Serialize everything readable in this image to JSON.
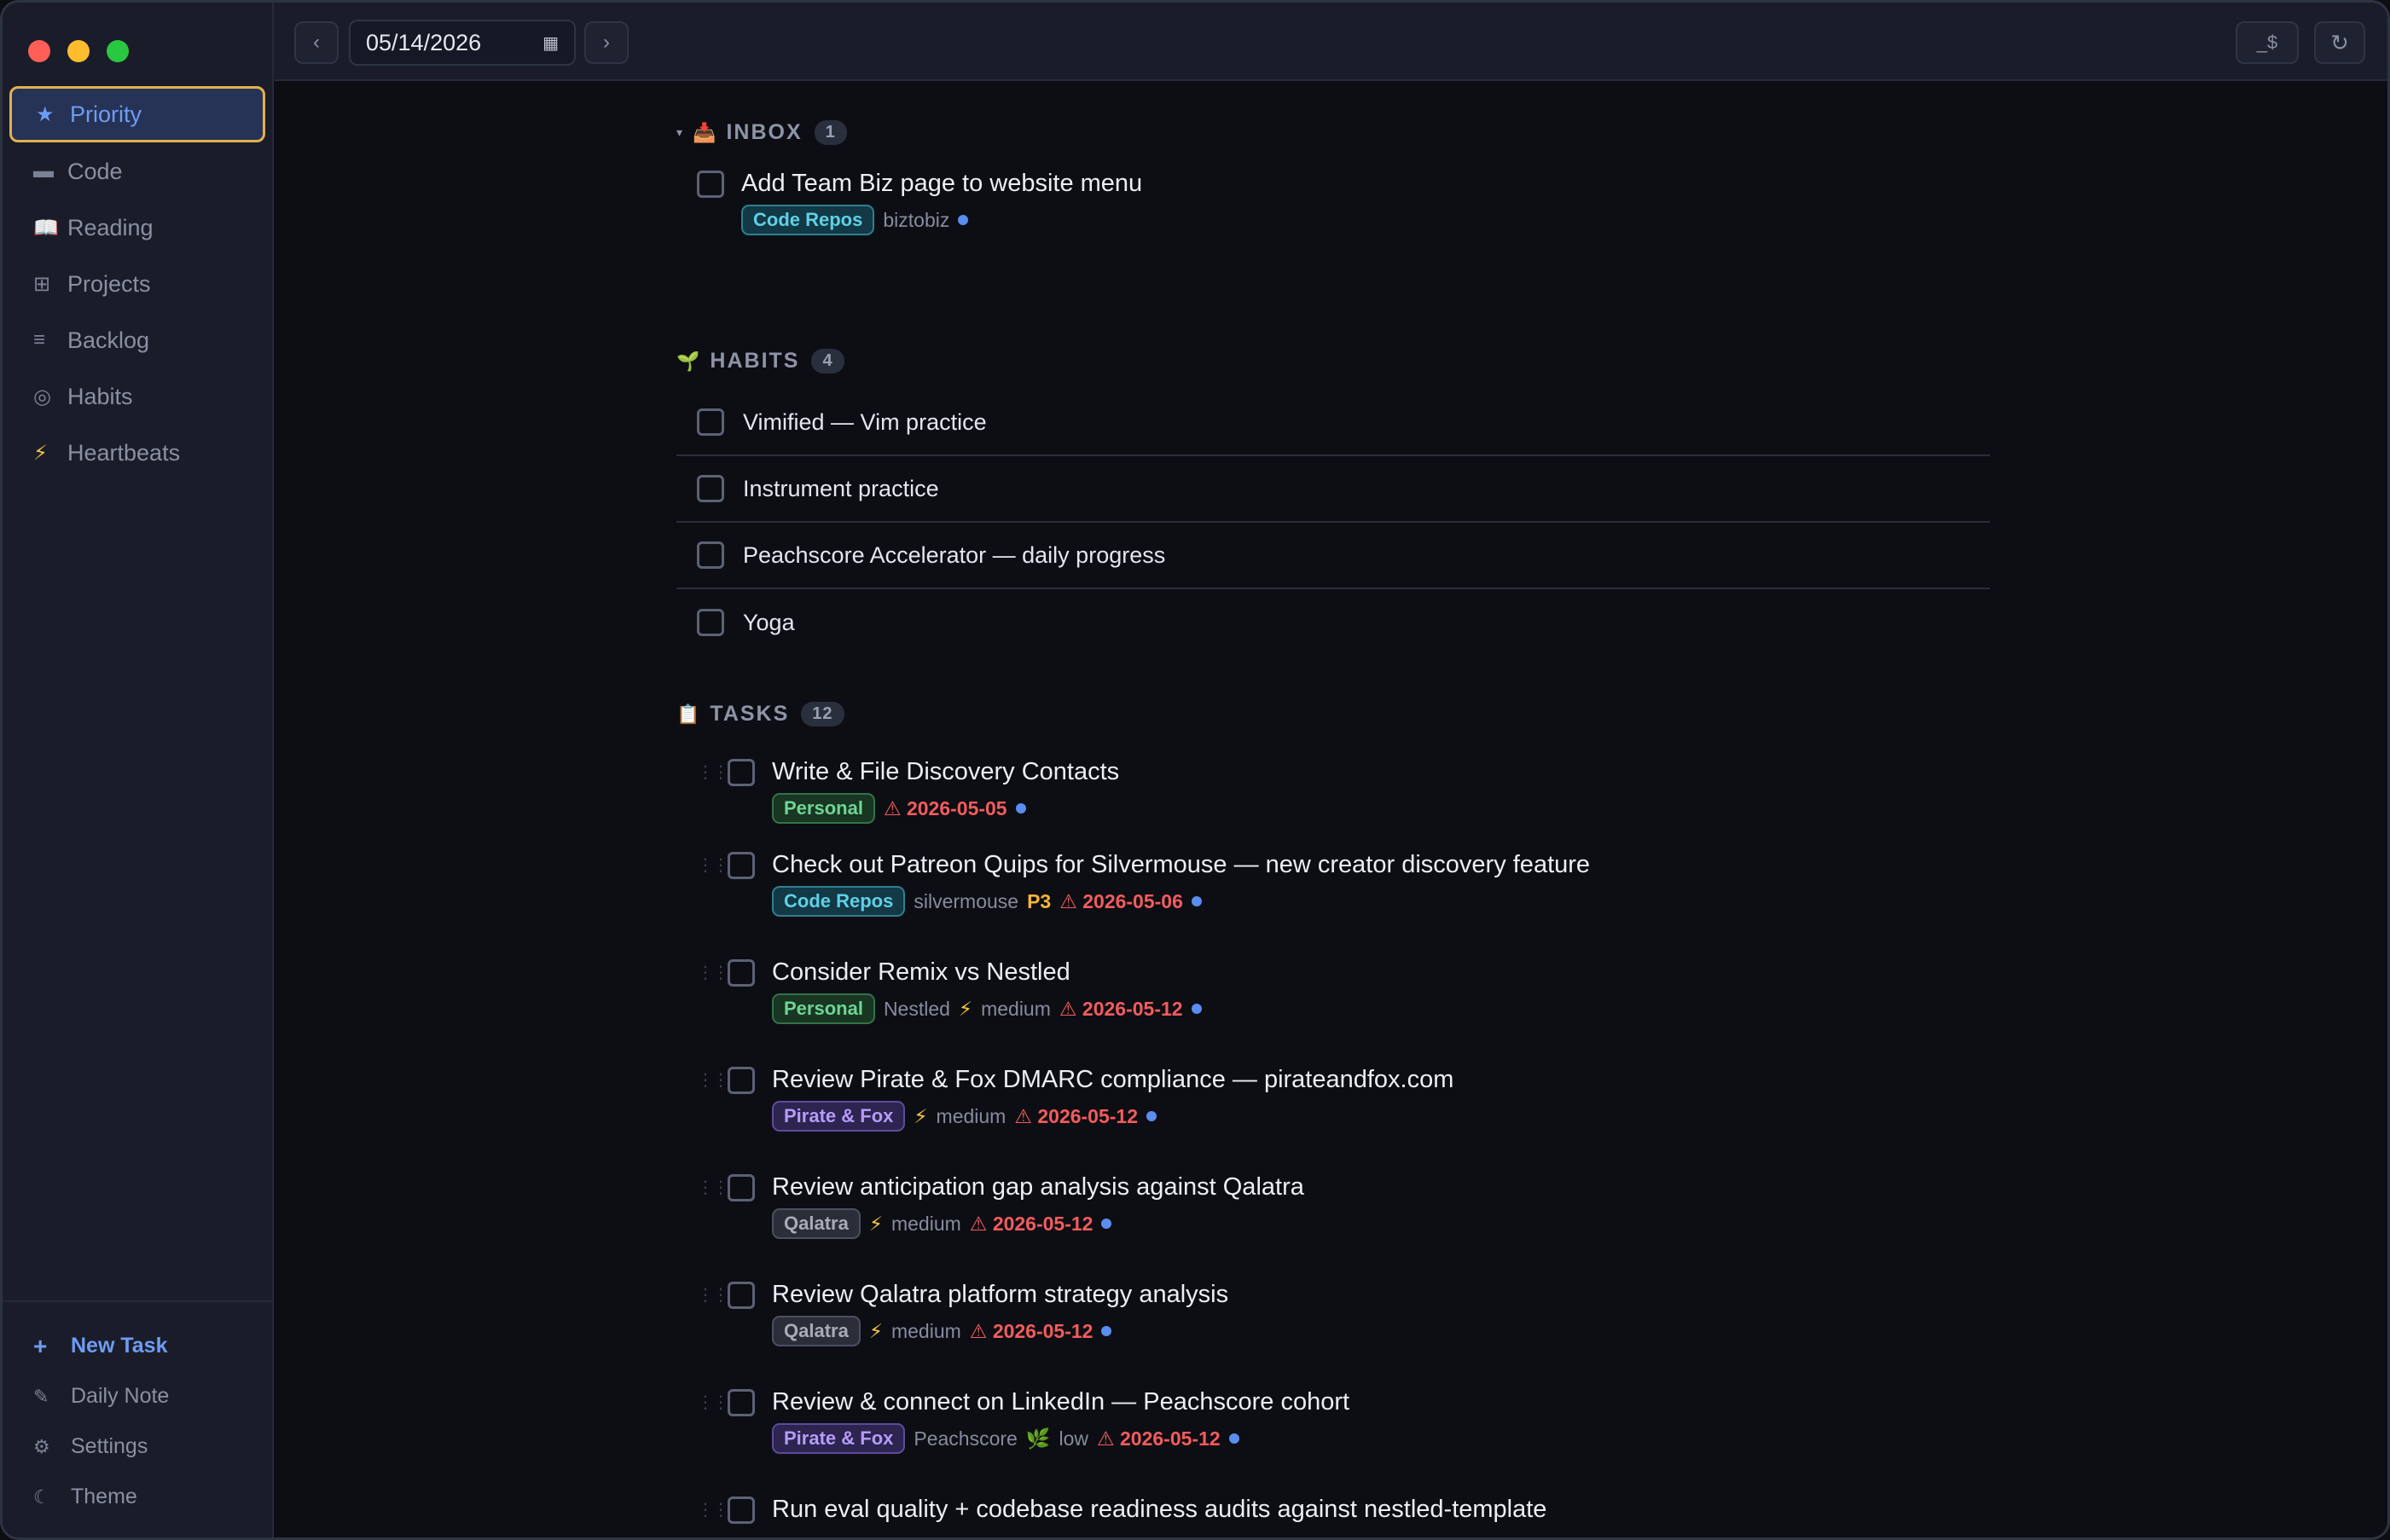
{
  "toolbar": {
    "prev_label": "‹",
    "next_label": "›",
    "date": "05/14/2026",
    "console_label": "_$",
    "refresh_label": "↻"
  },
  "sidebar": {
    "items": [
      {
        "label": "Priority",
        "icon": "star-icon",
        "glyph": "★",
        "active": true
      },
      {
        "label": "Code",
        "icon": "code-icon",
        "glyph": "▬"
      },
      {
        "label": "Reading",
        "icon": "book-icon",
        "glyph": "📖"
      },
      {
        "label": "Projects",
        "icon": "grid-icon",
        "glyph": "⊞"
      },
      {
        "label": "Backlog",
        "icon": "list-icon",
        "glyph": "≡"
      },
      {
        "label": "Habits",
        "icon": "circle-icon",
        "glyph": "◎"
      },
      {
        "label": "Heartbeats",
        "icon": "bolt-icon",
        "glyph": "⚡"
      }
    ],
    "footer": {
      "new_task": "New Task",
      "daily_note": "Daily Note",
      "settings": "Settings",
      "theme": "Theme"
    }
  },
  "inbox": {
    "title": "INBOX",
    "count": "1",
    "tasks": [
      {
        "title": "Add Team Biz page to website menu",
        "tag": "Code Repos",
        "project": "biztobiz"
      }
    ]
  },
  "habits": {
    "title": "HABITS",
    "count": "4",
    "items": [
      "Vimified — Vim practice",
      "Instrument practice",
      "Peachscore Accelerator — daily progress",
      "Yoga"
    ]
  },
  "tasks": {
    "title": "TASKS",
    "count": "12",
    "items": [
      {
        "title": "Write & File Discovery Contacts",
        "tag": "Personal",
        "due": "2026-05-05"
      },
      {
        "title": "Check out Patreon Quips for Silvermouse — new creator discovery feature",
        "tag": "Code Repos",
        "project": "silvermouse",
        "priority": "P3",
        "due": "2026-05-06"
      },
      {
        "title": "Consider Remix vs Nestled",
        "tag": "Personal",
        "project": "Nestled",
        "energy": "medium",
        "due": "2026-05-12"
      },
      {
        "title": "Review Pirate & Fox DMARC compliance — pirateandfox.com",
        "tag": "Pirate & Fox",
        "energy": "medium",
        "due": "2026-05-12"
      },
      {
        "title": "Review anticipation gap analysis against Qalatra",
        "tag": "Qalatra",
        "energy": "medium",
        "due": "2026-05-12"
      },
      {
        "title": "Review Qalatra platform strategy analysis",
        "tag": "Qalatra",
        "energy": "medium",
        "due": "2026-05-12"
      },
      {
        "title": "Review & connect on LinkedIn — Peachscore cohort",
        "tag": "Pirate & Fox",
        "project": "Peachscore",
        "energy": "low",
        "due": "2026-05-12"
      },
      {
        "title": "Run eval quality + codebase readiness audits against nestled-template"
      }
    ]
  },
  "colors": {
    "accent": "#6e9cf5",
    "active_border": "#e1b14e",
    "overdue": "#f25c5c"
  }
}
